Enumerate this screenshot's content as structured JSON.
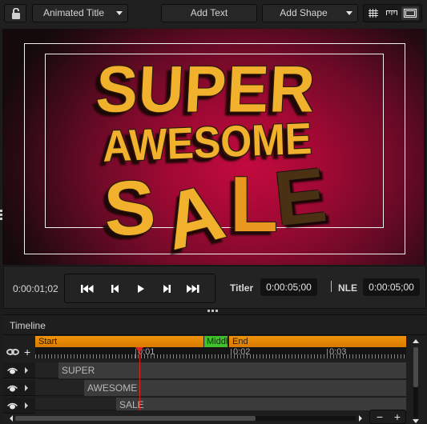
{
  "toolbar": {
    "lock_icon": "unlocked-padlock-icon",
    "template_dropdown": {
      "selected": "Animated Title"
    },
    "add_text_label": "Add Text",
    "add_shape_dropdown": {
      "selected": "Add Shape"
    },
    "view_toggles": [
      {
        "icon": "grid-icon",
        "active": false
      },
      {
        "icon": "ruler-icon",
        "active": false
      },
      {
        "icon": "safe-area-icon",
        "active": true
      }
    ]
  },
  "preview": {
    "title_lines": [
      "SUPER",
      "AWESOME"
    ],
    "sale_letters": [
      "S",
      "A",
      "L",
      "E"
    ],
    "colors": {
      "text": "#f2b12c",
      "background_center": "#c30a3e",
      "background_edge": "#140a0c",
      "faded_letter": "#4a3114"
    }
  },
  "transport": {
    "current_time": "0:00:01;02",
    "buttons": [
      {
        "name": "go-to-start",
        "icon": "skip-to-start-icon"
      },
      {
        "name": "step-back",
        "icon": "step-back-icon"
      },
      {
        "name": "play",
        "icon": "play-icon"
      },
      {
        "name": "step-forward",
        "icon": "step-forward-icon"
      },
      {
        "name": "go-to-end",
        "icon": "skip-to-end-icon"
      }
    ],
    "titler_label": "Titler",
    "titler_duration": "0:00:05;00",
    "nle_label": "NLE",
    "nle_duration": "0:00:05;00"
  },
  "timeline": {
    "title": "Timeline",
    "markers": [
      {
        "label": "Start",
        "color": "#e88a04"
      },
      {
        "label": "Middle",
        "color": "#3ec12a"
      },
      {
        "label": "End",
        "color": "#e88a04"
      }
    ],
    "ruler_labels": [
      "0:01",
      "0:02",
      "0:03"
    ],
    "playhead_time": "0:00:01;02",
    "add_track_label": "+",
    "tracks": [
      {
        "name": "SUPER",
        "visible": true
      },
      {
        "name": "AWESOME",
        "visible": true
      },
      {
        "name": "SALE",
        "visible": true
      }
    ],
    "zoom_out_label": "−",
    "zoom_in_label": "+"
  }
}
